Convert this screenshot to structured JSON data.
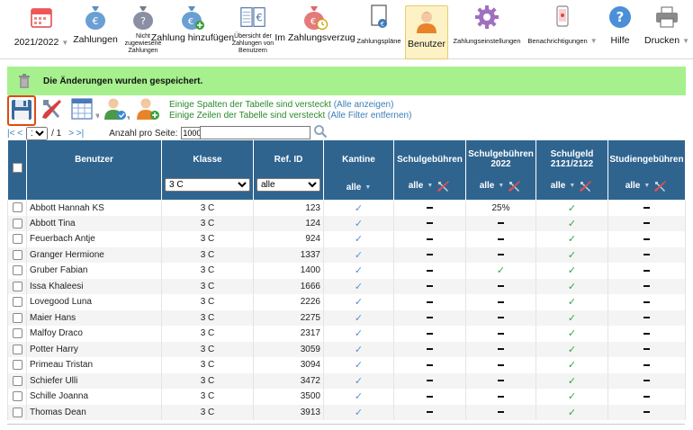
{
  "toolbar": {
    "items": [
      {
        "label": "2021/2022",
        "icon": "calendar-icon",
        "dropdown": true
      },
      {
        "label": "Zahlungen",
        "icon": "money-bag-icon"
      },
      {
        "label": "Nicht zugewiesene Zahlungen",
        "icon": "money-bag-question-icon"
      },
      {
        "label": "Zahlung hinzufügen",
        "icon": "money-bag-add-icon"
      },
      {
        "label": "Übersicht der Zahlungen von Benutzern",
        "icon": "book-euro-icon"
      },
      {
        "label": "Im Zahlungsverzug",
        "icon": "money-bag-clock-icon"
      },
      {
        "label": "Zahlungspläne",
        "icon": "document-coin-icon"
      },
      {
        "label": "Benutzer",
        "icon": "user-icon",
        "active": true
      },
      {
        "label": "Zahlungseinstellungen",
        "icon": "gear-icon"
      },
      {
        "label": "Benachrichtigungen",
        "icon": "phone-icon",
        "dropdown": true
      },
      {
        "label": "Hilfe",
        "icon": "help-icon"
      },
      {
        "label": "Drucken",
        "icon": "printer-icon",
        "dropdown": true
      }
    ]
  },
  "message": {
    "text": "Die Änderungen wurden gespeichert.",
    "icon": "trash-icon",
    "color": "#a6f18e"
  },
  "actions": {
    "icons": [
      "save-icon",
      "tools-icon",
      "columns-icon",
      "user-check-icon",
      "user-add-icon"
    ],
    "notes": [
      {
        "text": "Einige Spalten der Tabelle sind versteckt",
        "link": "(Alle anzeigen)"
      },
      {
        "text": "Einige Zeilen der Tabelle sind versteckt",
        "link": "(Alle Filter entfernen)"
      }
    ]
  },
  "pager": {
    "first": "|< <",
    "page": "1",
    "of": "/ 1",
    "last": "> >|",
    "per_page_label": "Anzahl pro Seite:",
    "per_page_value": "1000",
    "search_value": ""
  },
  "table": {
    "header_color": "#2f648f",
    "columns": [
      {
        "label": "",
        "type": "checkbox"
      },
      {
        "label": "Benutzer"
      },
      {
        "label": "Klasse",
        "filter_select": "3 C"
      },
      {
        "label": "Ref. ID",
        "filter_select": "alle"
      },
      {
        "label": "Kantine",
        "filter": "alle"
      },
      {
        "label": "Schulgebühren",
        "filter": "alle",
        "tools": true
      },
      {
        "label": "Schulgebühren 2022",
        "filter": "alle",
        "tools": true
      },
      {
        "label": "Schulgeld 2121/2122",
        "filter": "alle",
        "tools": true
      },
      {
        "label": "Studiengebühren",
        "filter": "alle",
        "tools": true
      }
    ],
    "rows": [
      {
        "name": "Abbott Hannah KS",
        "klasse": "3 C",
        "ref": "123",
        "kantine": "check",
        "sg": "dash",
        "sg22": "25%",
        "schulgeld": "check-green",
        "studien": "dash"
      },
      {
        "name": "Abbott Tina",
        "klasse": "3 C",
        "ref": "124",
        "kantine": "check",
        "sg": "dash",
        "sg22": "dash",
        "schulgeld": "check-green",
        "studien": "dash"
      },
      {
        "name": "Feuerbach Antje",
        "klasse": "3 C",
        "ref": "924",
        "kantine": "check",
        "sg": "dash",
        "sg22": "dash",
        "schulgeld": "check-green",
        "studien": "dash"
      },
      {
        "name": "Granger Hermione",
        "klasse": "3 C",
        "ref": "1337",
        "kantine": "check",
        "sg": "dash",
        "sg22": "dash",
        "schulgeld": "check-green",
        "studien": "dash"
      },
      {
        "name": "Gruber Fabian",
        "klasse": "3 C",
        "ref": "1400",
        "kantine": "check",
        "sg": "dash",
        "sg22": "check-green",
        "schulgeld": "check-green",
        "studien": "dash"
      },
      {
        "name": "Issa Khaleesi",
        "klasse": "3 C",
        "ref": "1666",
        "kantine": "check",
        "sg": "dash",
        "sg22": "dash",
        "schulgeld": "check-green",
        "studien": "dash"
      },
      {
        "name": "Lovegood Luna",
        "klasse": "3 C",
        "ref": "2226",
        "kantine": "check",
        "sg": "dash",
        "sg22": "dash",
        "schulgeld": "check-green",
        "studien": "dash"
      },
      {
        "name": "Maier Hans",
        "klasse": "3 C",
        "ref": "2275",
        "kantine": "check",
        "sg": "dash",
        "sg22": "dash",
        "schulgeld": "check-green",
        "studien": "dash"
      },
      {
        "name": "Malfoy Draco",
        "klasse": "3 C",
        "ref": "2317",
        "kantine": "check",
        "sg": "dash",
        "sg22": "dash",
        "schulgeld": "check-green",
        "studien": "dash"
      },
      {
        "name": "Potter Harry",
        "klasse": "3 C",
        "ref": "3059",
        "kantine": "check",
        "sg": "dash",
        "sg22": "dash",
        "schulgeld": "check-green",
        "studien": "dash"
      },
      {
        "name": "Primeau Tristan",
        "klasse": "3 C",
        "ref": "3094",
        "kantine": "check",
        "sg": "dash",
        "sg22": "dash",
        "schulgeld": "check-green",
        "studien": "dash"
      },
      {
        "name": "Schiefer Ulli",
        "klasse": "3 C",
        "ref": "3472",
        "kantine": "check",
        "sg": "dash",
        "sg22": "dash",
        "schulgeld": "check-green",
        "studien": "dash"
      },
      {
        "name": "Schille Joanna",
        "klasse": "3 C",
        "ref": "3500",
        "kantine": "check",
        "sg": "dash",
        "sg22": "dash",
        "schulgeld": "check-green",
        "studien": "dash"
      },
      {
        "name": "Thomas Dean",
        "klasse": "3 C",
        "ref": "3913",
        "kantine": "check",
        "sg": "dash",
        "sg22": "dash",
        "schulgeld": "check-green",
        "studien": "dash"
      }
    ]
  }
}
